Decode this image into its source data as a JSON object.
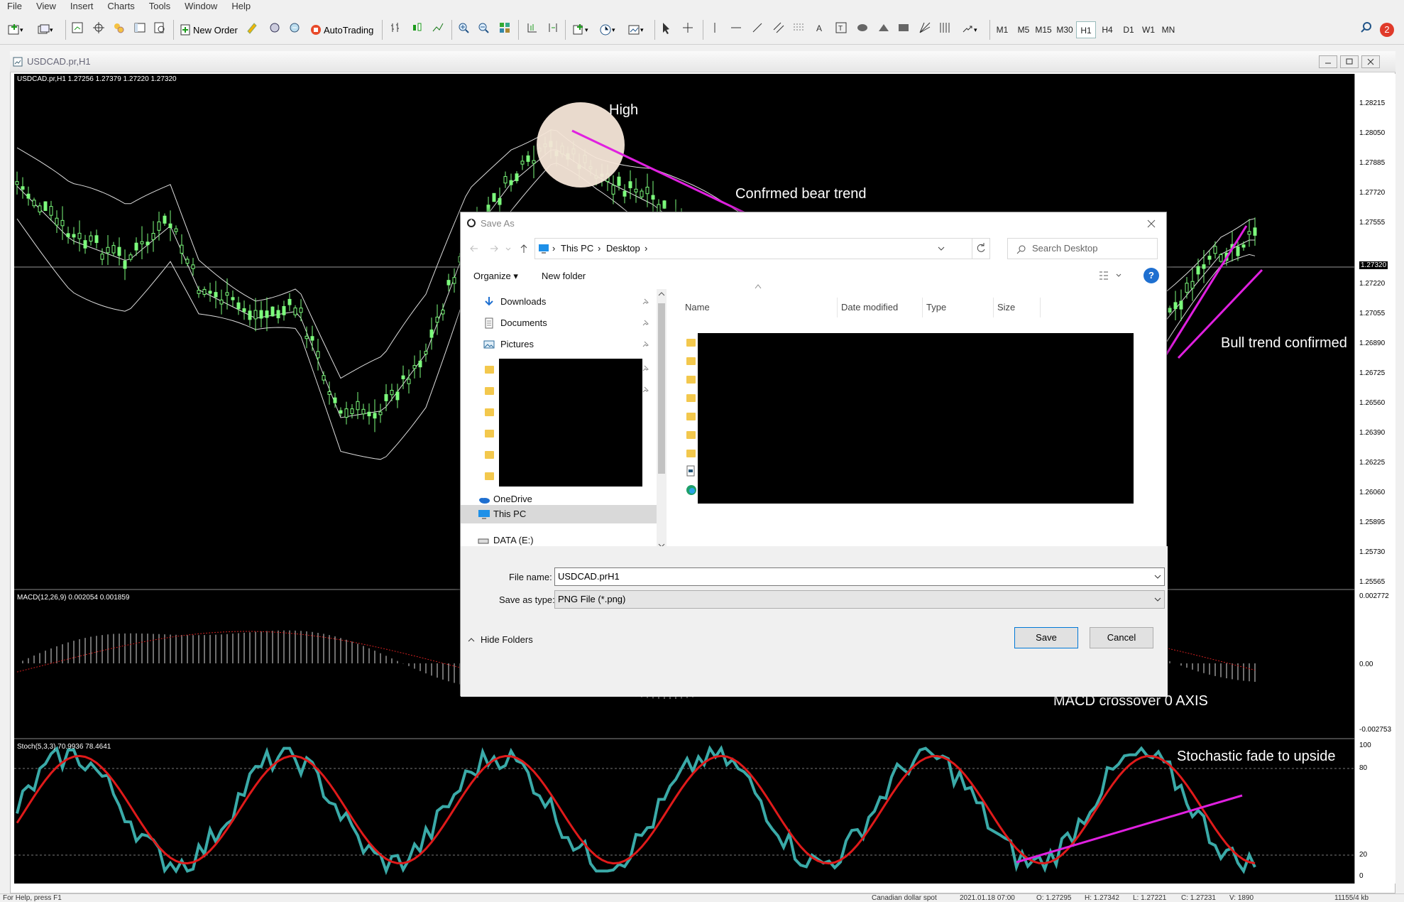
{
  "menu": [
    "File",
    "View",
    "Insert",
    "Charts",
    "Tools",
    "Window",
    "Help"
  ],
  "toolbar": {
    "new_order_label": "New Order",
    "autotrading_label": "AutoTrading",
    "timeframes": [
      "M1",
      "M5",
      "M15",
      "M30",
      "H1",
      "H4",
      "D1",
      "W1",
      "MN"
    ],
    "active_timeframe": "H1",
    "alerts_count": "2"
  },
  "chart_window": {
    "title": "USDCAD.pr,H1",
    "header_info": "USDCAD.pr,H1  1.27256 1.27379 1.27220 1.27320",
    "price_labels": [
      "1.28215",
      "1.28050",
      "1.27885",
      "1.27720",
      "1.27555",
      "1.27320",
      "1.27220",
      "1.27055",
      "1.26890",
      "1.26725",
      "1.26560",
      "1.26390",
      "1.26225",
      "1.26060",
      "1.25895",
      "1.25730",
      "1.25565"
    ],
    "current_price": "1.27320",
    "macd_label": "MACD(12,26,9) 0.002054 0.001859",
    "macd_axis": [
      "0.002772",
      "0.00",
      "-0.002753"
    ],
    "stoch_label": "Stoch(5,3,3) 70.9936 78.4641",
    "stoch_axis": [
      "100",
      "80",
      "20",
      "0"
    ],
    "annotations": {
      "high": "High",
      "bear": "Confrmed bear trend",
      "bull": "Bull trend confirmed",
      "macd": "MACD crossover 0 AXIS",
      "stoch": "Stochastic fade to upside"
    },
    "colors": {
      "annotation_line": "#e020e0",
      "candle": "#7cfc7c",
      "stoch_main": "#3aaaa8",
      "stoch_signal": "#e01a1a",
      "macd_signal": "#d02020"
    }
  },
  "status_bar": {
    "help": "For Help, press F1",
    "symbol": "Canadian dollar spot",
    "datetime": "2021.01.18 07:00",
    "open": "O: 1.27295",
    "high": "H: 1.27342",
    "low": "L: 1.27221",
    "close": "C: 1.27231",
    "volume": "V: 1890",
    "traffic": "11155/4 kb"
  },
  "dialog": {
    "title": "Save As",
    "breadcrumb": [
      "This PC",
      "Desktop"
    ],
    "search_placeholder": "Search Desktop",
    "organize_label": "Organize ▾",
    "new_folder_label": "New folder",
    "nav_items": [
      "Downloads",
      "Documents",
      "Pictures"
    ],
    "onedrive_label": "OneDrive",
    "thispc_label": "This PC",
    "data_drive_label": "DATA (E:)",
    "columns": [
      "Name",
      "Date modified",
      "Type",
      "Size"
    ],
    "file_name_label": "File name:",
    "file_name_value": "USDCAD.prH1",
    "save_type_label": "Save as type:",
    "save_type_value": "PNG File (*.png)",
    "hide_folders_label": "Hide Folders",
    "save_label": "Save",
    "cancel_label": "Cancel"
  }
}
